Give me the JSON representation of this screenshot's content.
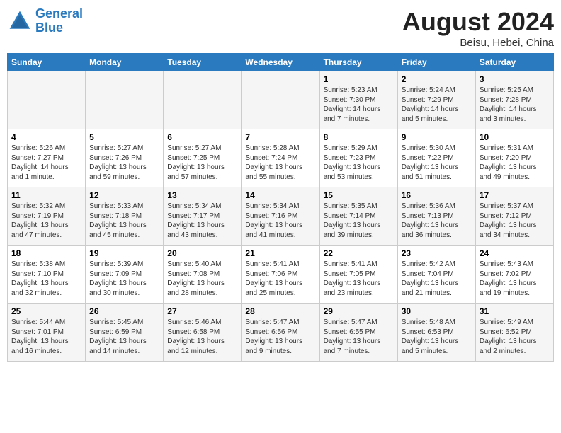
{
  "header": {
    "logo_line1": "General",
    "logo_line2": "Blue",
    "month": "August 2024",
    "location": "Beisu, Hebei, China"
  },
  "days_of_week": [
    "Sunday",
    "Monday",
    "Tuesday",
    "Wednesday",
    "Thursday",
    "Friday",
    "Saturday"
  ],
  "weeks": [
    [
      {
        "day": "",
        "info": ""
      },
      {
        "day": "",
        "info": ""
      },
      {
        "day": "",
        "info": ""
      },
      {
        "day": "",
        "info": ""
      },
      {
        "day": "1",
        "info": "Sunrise: 5:23 AM\nSunset: 7:30 PM\nDaylight: 14 hours\nand 7 minutes."
      },
      {
        "day": "2",
        "info": "Sunrise: 5:24 AM\nSunset: 7:29 PM\nDaylight: 14 hours\nand 5 minutes."
      },
      {
        "day": "3",
        "info": "Sunrise: 5:25 AM\nSunset: 7:28 PM\nDaylight: 14 hours\nand 3 minutes."
      }
    ],
    [
      {
        "day": "4",
        "info": "Sunrise: 5:26 AM\nSunset: 7:27 PM\nDaylight: 14 hours\nand 1 minute."
      },
      {
        "day": "5",
        "info": "Sunrise: 5:27 AM\nSunset: 7:26 PM\nDaylight: 13 hours\nand 59 minutes."
      },
      {
        "day": "6",
        "info": "Sunrise: 5:27 AM\nSunset: 7:25 PM\nDaylight: 13 hours\nand 57 minutes."
      },
      {
        "day": "7",
        "info": "Sunrise: 5:28 AM\nSunset: 7:24 PM\nDaylight: 13 hours\nand 55 minutes."
      },
      {
        "day": "8",
        "info": "Sunrise: 5:29 AM\nSunset: 7:23 PM\nDaylight: 13 hours\nand 53 minutes."
      },
      {
        "day": "9",
        "info": "Sunrise: 5:30 AM\nSunset: 7:22 PM\nDaylight: 13 hours\nand 51 minutes."
      },
      {
        "day": "10",
        "info": "Sunrise: 5:31 AM\nSunset: 7:20 PM\nDaylight: 13 hours\nand 49 minutes."
      }
    ],
    [
      {
        "day": "11",
        "info": "Sunrise: 5:32 AM\nSunset: 7:19 PM\nDaylight: 13 hours\nand 47 minutes."
      },
      {
        "day": "12",
        "info": "Sunrise: 5:33 AM\nSunset: 7:18 PM\nDaylight: 13 hours\nand 45 minutes."
      },
      {
        "day": "13",
        "info": "Sunrise: 5:34 AM\nSunset: 7:17 PM\nDaylight: 13 hours\nand 43 minutes."
      },
      {
        "day": "14",
        "info": "Sunrise: 5:34 AM\nSunset: 7:16 PM\nDaylight: 13 hours\nand 41 minutes."
      },
      {
        "day": "15",
        "info": "Sunrise: 5:35 AM\nSunset: 7:14 PM\nDaylight: 13 hours\nand 39 minutes."
      },
      {
        "day": "16",
        "info": "Sunrise: 5:36 AM\nSunset: 7:13 PM\nDaylight: 13 hours\nand 36 minutes."
      },
      {
        "day": "17",
        "info": "Sunrise: 5:37 AM\nSunset: 7:12 PM\nDaylight: 13 hours\nand 34 minutes."
      }
    ],
    [
      {
        "day": "18",
        "info": "Sunrise: 5:38 AM\nSunset: 7:10 PM\nDaylight: 13 hours\nand 32 minutes."
      },
      {
        "day": "19",
        "info": "Sunrise: 5:39 AM\nSunset: 7:09 PM\nDaylight: 13 hours\nand 30 minutes."
      },
      {
        "day": "20",
        "info": "Sunrise: 5:40 AM\nSunset: 7:08 PM\nDaylight: 13 hours\nand 28 minutes."
      },
      {
        "day": "21",
        "info": "Sunrise: 5:41 AM\nSunset: 7:06 PM\nDaylight: 13 hours\nand 25 minutes."
      },
      {
        "day": "22",
        "info": "Sunrise: 5:41 AM\nSunset: 7:05 PM\nDaylight: 13 hours\nand 23 minutes."
      },
      {
        "day": "23",
        "info": "Sunrise: 5:42 AM\nSunset: 7:04 PM\nDaylight: 13 hours\nand 21 minutes."
      },
      {
        "day": "24",
        "info": "Sunrise: 5:43 AM\nSunset: 7:02 PM\nDaylight: 13 hours\nand 19 minutes."
      }
    ],
    [
      {
        "day": "25",
        "info": "Sunrise: 5:44 AM\nSunset: 7:01 PM\nDaylight: 13 hours\nand 16 minutes."
      },
      {
        "day": "26",
        "info": "Sunrise: 5:45 AM\nSunset: 6:59 PM\nDaylight: 13 hours\nand 14 minutes."
      },
      {
        "day": "27",
        "info": "Sunrise: 5:46 AM\nSunset: 6:58 PM\nDaylight: 13 hours\nand 12 minutes."
      },
      {
        "day": "28",
        "info": "Sunrise: 5:47 AM\nSunset: 6:56 PM\nDaylight: 13 hours\nand 9 minutes."
      },
      {
        "day": "29",
        "info": "Sunrise: 5:47 AM\nSunset: 6:55 PM\nDaylight: 13 hours\nand 7 minutes."
      },
      {
        "day": "30",
        "info": "Sunrise: 5:48 AM\nSunset: 6:53 PM\nDaylight: 13 hours\nand 5 minutes."
      },
      {
        "day": "31",
        "info": "Sunrise: 5:49 AM\nSunset: 6:52 PM\nDaylight: 13 hours\nand 2 minutes."
      }
    ]
  ]
}
